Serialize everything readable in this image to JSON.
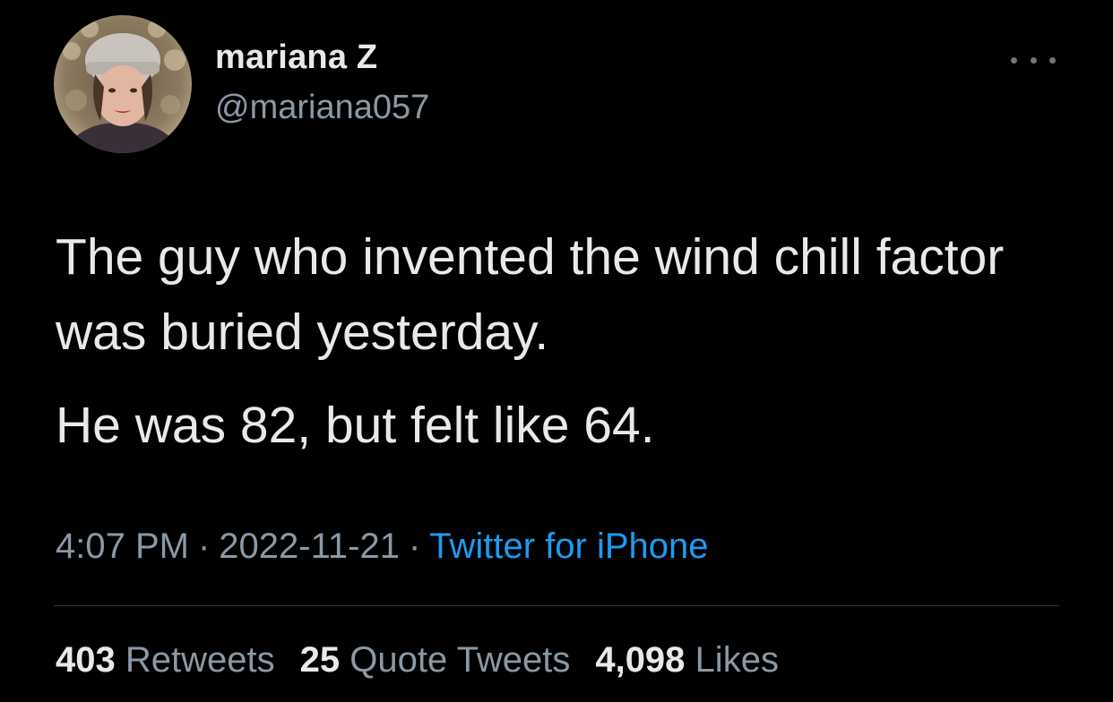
{
  "author": {
    "display_name": "mariana Z",
    "handle": "@mariana057",
    "avatar_icon": "profile-photo"
  },
  "more_icon": "ellipsis-icon",
  "tweet": {
    "text_line_1": "The guy who invented the wind chill factor was buried yesterday.",
    "text_line_2": "He was 82, but felt like 64."
  },
  "meta": {
    "time": "4:07 PM",
    "separator": "·",
    "date": "2022-11-21",
    "source": "Twitter for iPhone"
  },
  "stats": {
    "retweets_count": "403",
    "retweets_label": "Retweets",
    "quotes_count": "25",
    "quotes_label": "Quote Tweets",
    "likes_count": "4,098",
    "likes_label": "Likes"
  },
  "colors": {
    "background": "#000000",
    "primary_text": "#e7e9ea",
    "secondary_text": "#8b98a5",
    "link": "#1d9bf0",
    "divider": "#2f3336"
  }
}
